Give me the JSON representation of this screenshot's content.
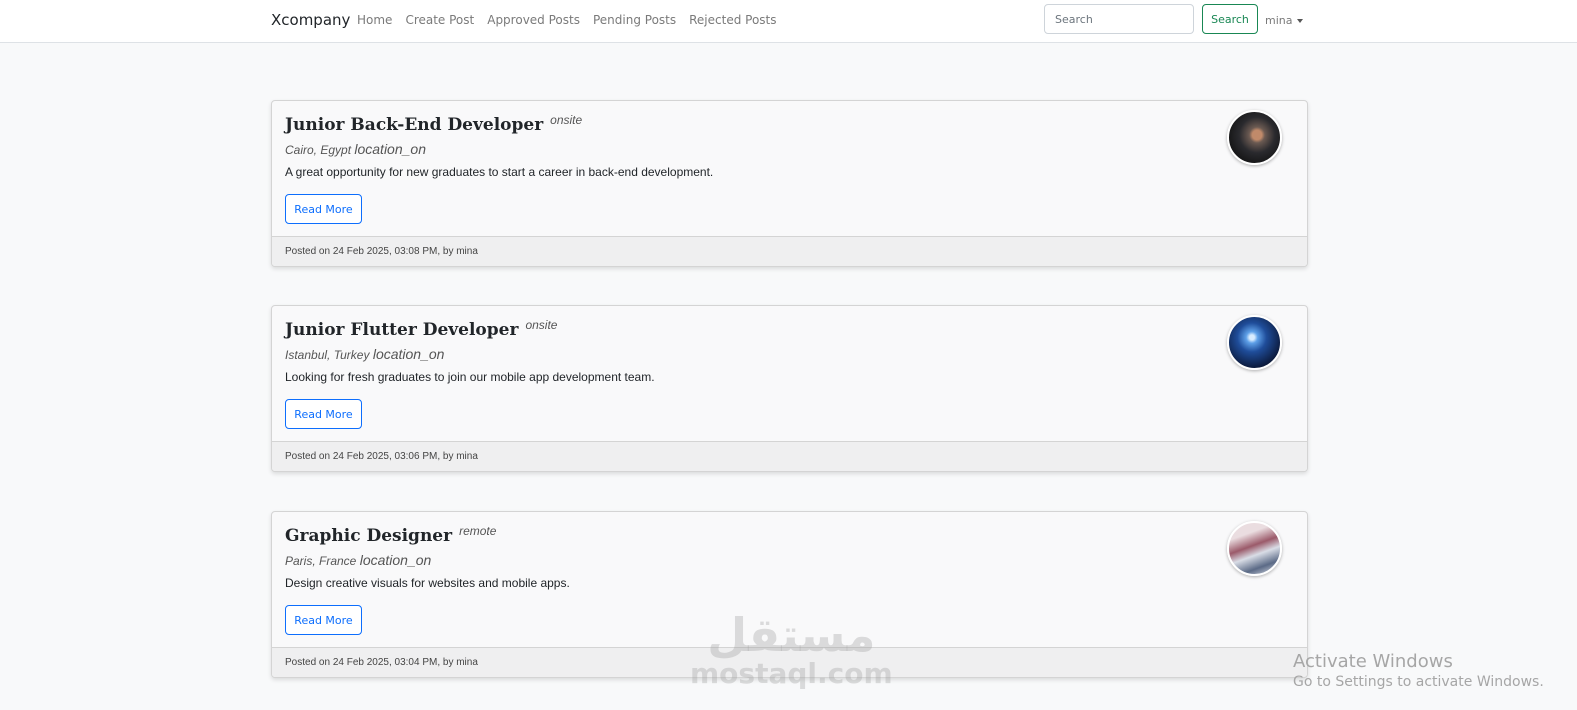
{
  "navbar": {
    "brand": "Xcompany",
    "links": [
      "Home",
      "Create Post",
      "Approved Posts",
      "Pending Posts",
      "Rejected Posts"
    ],
    "search_placeholder": "Search",
    "search_button": "Search",
    "user": "mina"
  },
  "posts": [
    {
      "title": "Junior Back-End Developer",
      "type": "onsite",
      "location": "Cairo, Egypt",
      "location_icon": "location_on",
      "description": "A great opportunity for new graduates to start a career in back-end development.",
      "button": "Read More",
      "footer": "Posted on 24 Feb 2025, 03:08 PM, by mina",
      "image": "hand-touching-digital-network"
    },
    {
      "title": "Junior Flutter Developer",
      "type": "onsite",
      "location": "Istanbul, Turkey",
      "location_icon": "location_on",
      "description": "Looking for fresh graduates to join our mobile app development team.",
      "button": "Read More",
      "footer": "Posted on 24 Feb 2025, 03:06 PM, by mina",
      "image": "astronaut-blue-space"
    },
    {
      "title": "Graphic Designer",
      "type": "remote",
      "location": "Paris, France",
      "location_icon": "location_on",
      "description": "Design creative visuals for websites and mobile apps.",
      "button": "Read More",
      "footer": "Posted on 24 Feb 2025, 03:04 PM, by mina",
      "image": "designer-tablet-laptop"
    }
  ],
  "watermark": {
    "arabic": "مستقل",
    "latin": "mostaql.com"
  },
  "windows_activation": {
    "title": "Activate Windows",
    "subtitle": "Go to Settings to activate Windows."
  },
  "colors": {
    "primary": "#0d6efd",
    "success": "#198754",
    "page_bg": "#f8f9fa"
  }
}
